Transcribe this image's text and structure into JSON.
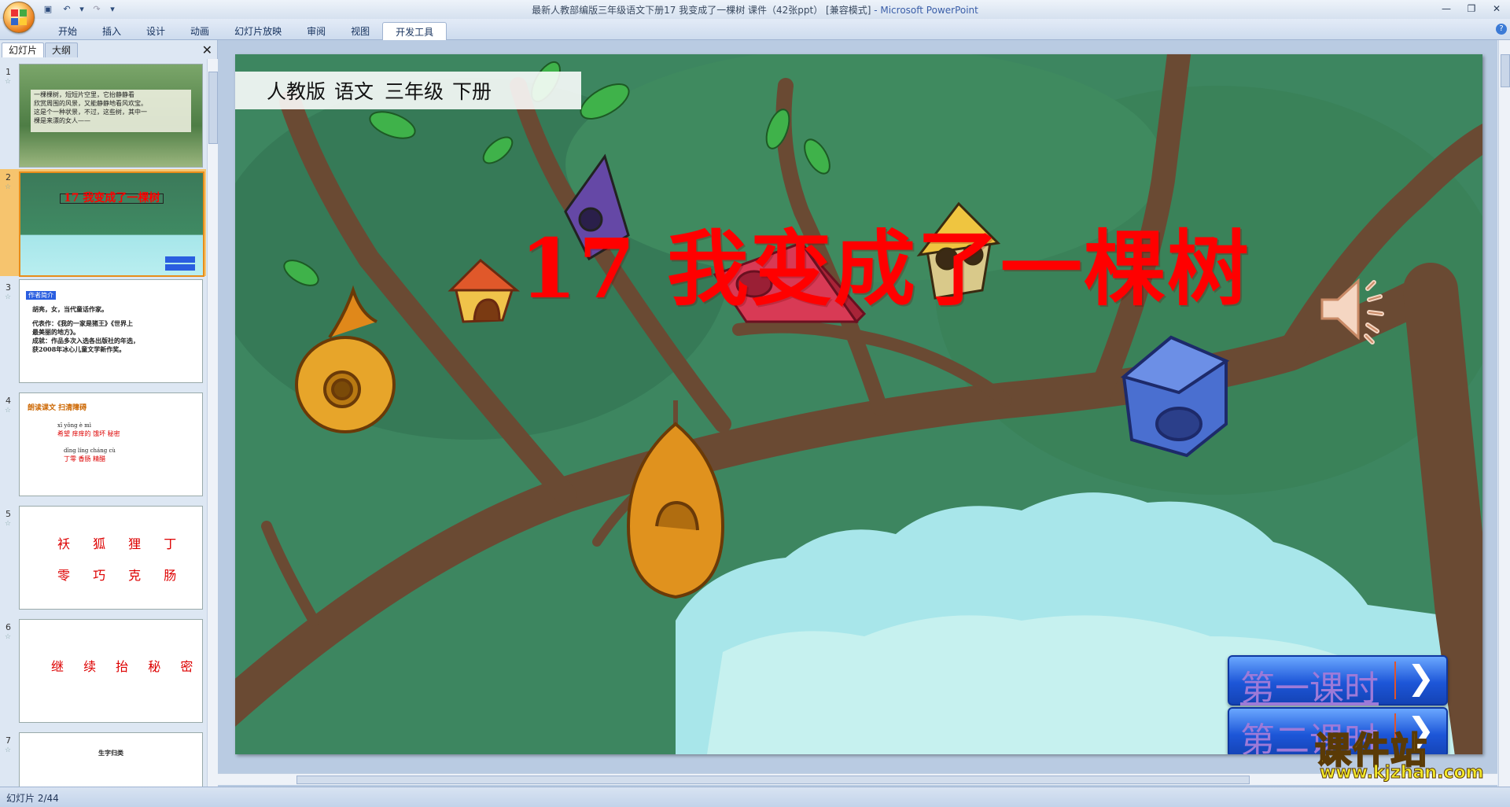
{
  "window": {
    "title": "最新人教部编版三年级语文下册17  我变成了一棵树 课件（42张ppt） [兼容模式]",
    "app_name": " - Microsoft PowerPoint"
  },
  "ribbon_tabs": [
    "开始",
    "插入",
    "设计",
    "动画",
    "幻灯片放映",
    "审阅",
    "视图",
    "开发工具"
  ],
  "panel": {
    "tabs": [
      "幻灯片",
      "大纲"
    ],
    "slides": [
      {
        "num": "1",
        "lines": [
          "一棵棵树，短短片空里，它抬静静看",
          "欣赏周围的风景，又能静静地看风欢宝。",
          "这是个一种状景，不过，这些树，其中一",
          "棵是来漂的女人——"
        ]
      },
      {
        "num": "2",
        "lines": [
          "17 我变成了一棵树"
        ]
      },
      {
        "num": "3",
        "lines": [
          "作者简介",
          "  胡亮，女，当代童话作家。",
          "  代表作：《我的一家是猪王》《世界上",
          "最美丽的地方》。",
          "  成就：作品多次入选各出版社的年选，",
          "获2008年冰心儿童文学新作奖。"
        ]
      },
      {
        "num": "4",
        "lines": [
          "朗读课文  扫清障碍",
          "  xī     yǒng    è      mì",
          "希望  痒痒的  饿坏  秘密",
          "  dīng líng   cháng   cù",
          "丁零   香肠   精醋"
        ]
      },
      {
        "num": "5",
        "lines": [
          "袄 狐 狸 丁",
          "零 巧 克 肠"
        ]
      },
      {
        "num": "6",
        "lines": [
          "继 续 抬 秘 密"
        ]
      },
      {
        "num": "7",
        "lines": [
          "生字归类"
        ]
      }
    ]
  },
  "slide": {
    "tags": [
      "人教版",
      "语文",
      "三年级",
      "下册"
    ],
    "title": "17   我变成了一棵树",
    "buttons": [
      {
        "label": "第一课时",
        "arrow": "❯"
      },
      {
        "label": "第二课时",
        "arrow": "❯"
      }
    ]
  },
  "watermark": {
    "big": "课件站",
    "small": "www.kjzhan.com"
  },
  "status": {
    "text": "幻灯片 2/44"
  },
  "colors": {
    "title_red": "#ff0000",
    "tree_green": "#3f8a63",
    "sky": "#9fe3ea",
    "button_blue": "#1d56d8"
  }
}
